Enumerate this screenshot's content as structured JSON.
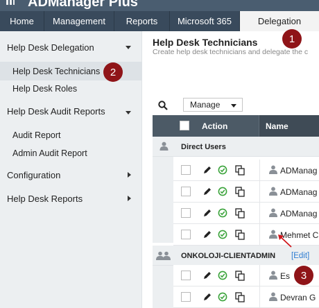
{
  "app": {
    "title": "ADManager Plus"
  },
  "nav": {
    "tabs": [
      "Home",
      "Management",
      "Reports",
      "Microsoft 365",
      "Delegation"
    ],
    "active": "Delegation"
  },
  "sidebar": {
    "sections": [
      {
        "label": "Help Desk Delegation",
        "expanded": true
      },
      {
        "label": "Help Desk Technicians",
        "sub": true,
        "selected": true
      },
      {
        "label": "Help Desk Roles",
        "sub": true
      },
      {
        "label": "Help Desk Audit Reports",
        "expanded": true
      },
      {
        "label": "Audit Report",
        "sub": true
      },
      {
        "label": "Admin Audit Report",
        "sub": true
      },
      {
        "label": "Configuration",
        "expanded": false
      },
      {
        "label": "Help Desk Reports",
        "expanded": false
      }
    ]
  },
  "main": {
    "title": "Help Desk Technicians",
    "description": "Create help desk technicians and delegate the c",
    "toolbar": {
      "manage_label": "Manage"
    },
    "table": {
      "headers": {
        "action": "Action",
        "name": "Name"
      },
      "groups": [
        {
          "label": "Direct Users",
          "edit": "",
          "rows": [
            "ADManag",
            "ADManag",
            "ADManag",
            "Mehmet C"
          ]
        },
        {
          "label": "ONKOLOJI-CLIENTADMIN",
          "edit": "[Edit]",
          "rows": [
            "Es",
            "Devran G"
          ]
        }
      ]
    }
  },
  "annotations": [
    "1",
    "2",
    "3"
  ],
  "colors": {
    "nav": "#394a5c",
    "header": "#4c5a66",
    "badge": "#8f1418",
    "link": "#2b7bd1",
    "check": "#3aa33a"
  }
}
